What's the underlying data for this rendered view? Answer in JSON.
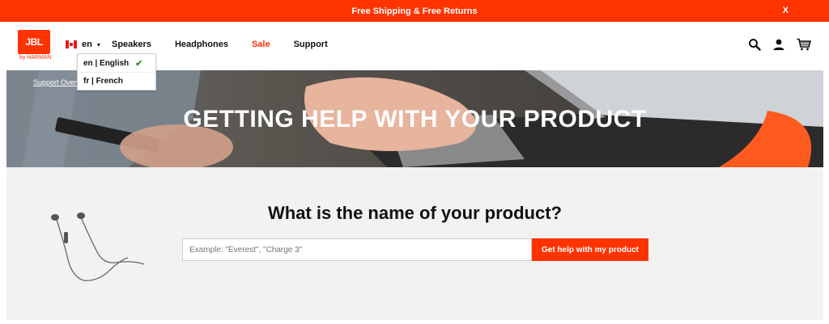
{
  "promo": {
    "text": "Free Shipping & Free Returns",
    "close": "X"
  },
  "header": {
    "logo_text": "JBL",
    "logo_sub": "by HARMAN",
    "lang_code": "en",
    "nav": [
      "Speakers",
      "Headphones",
      "Sale",
      "Support"
    ],
    "icons": [
      "search-icon",
      "account-icon",
      "cart-icon"
    ]
  },
  "language_menu": {
    "items": [
      {
        "label": "en | English",
        "selected": true
      },
      {
        "label": "fr | French",
        "selected": false
      }
    ]
  },
  "hero": {
    "breadcrumb": "Support Overview",
    "title": "GETTING HELP WITH YOUR PRODUCT"
  },
  "search": {
    "question": "What is the name of your product?",
    "placeholder": "Example: \"Everest\", \"Charge 3\"",
    "button": "Get help with my product"
  },
  "colors": {
    "accent": "#ff3300",
    "band": "#f2f2f2",
    "check": "#2a9a2a"
  }
}
